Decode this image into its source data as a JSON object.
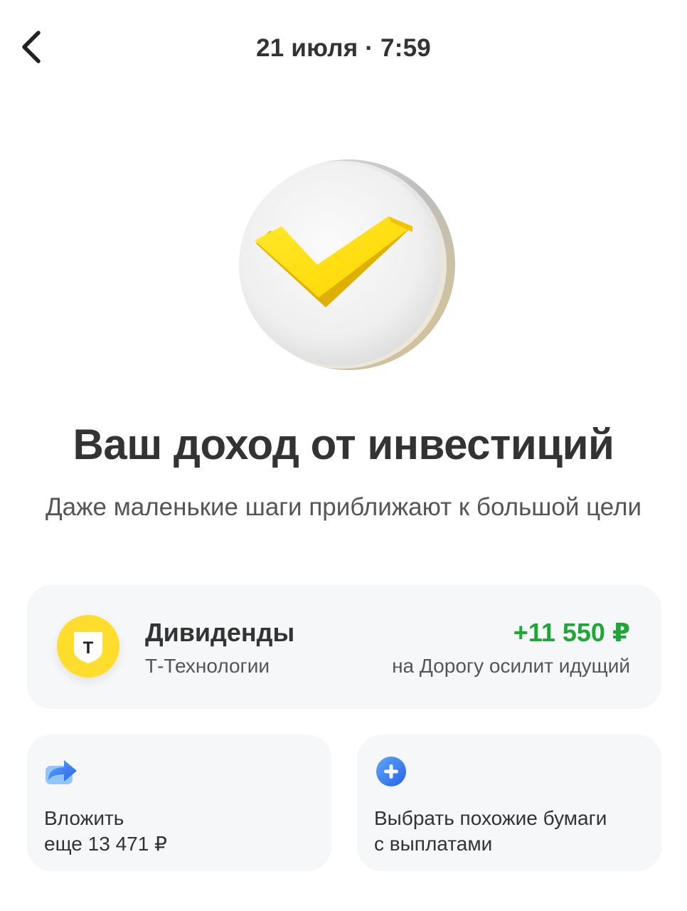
{
  "header": {
    "back_icon": "chevron-left-icon",
    "title": "21 июля · 7:59"
  },
  "illustration": {
    "icon": "yellow-checkmark-coin",
    "accent": "#ffdd2d"
  },
  "main": {
    "title": "Ваш доход от инвестиций",
    "subtitle": "Даже маленькие шаги приближают к большой цели"
  },
  "dividend": {
    "logo_letter": "Т",
    "title": "Дивиденды",
    "company": "Т-Технологии",
    "amount": "+11 550 ₽",
    "amount_color": "#1fa638",
    "goal": "на Дорогу осилит идущий"
  },
  "actions": [
    {
      "icon": "forward-arrow-icon",
      "line1": "Вложить",
      "line2": "еще 13 471 ₽"
    },
    {
      "icon": "plus-circle-icon",
      "line1": "Выбрать похожие бумаги",
      "line2": "с выплатами"
    }
  ],
  "colors": {
    "text": "#333333",
    "secondary_text": "#555555",
    "card_background": "#f6f7f8",
    "icon_blue": "#3b82f6"
  }
}
